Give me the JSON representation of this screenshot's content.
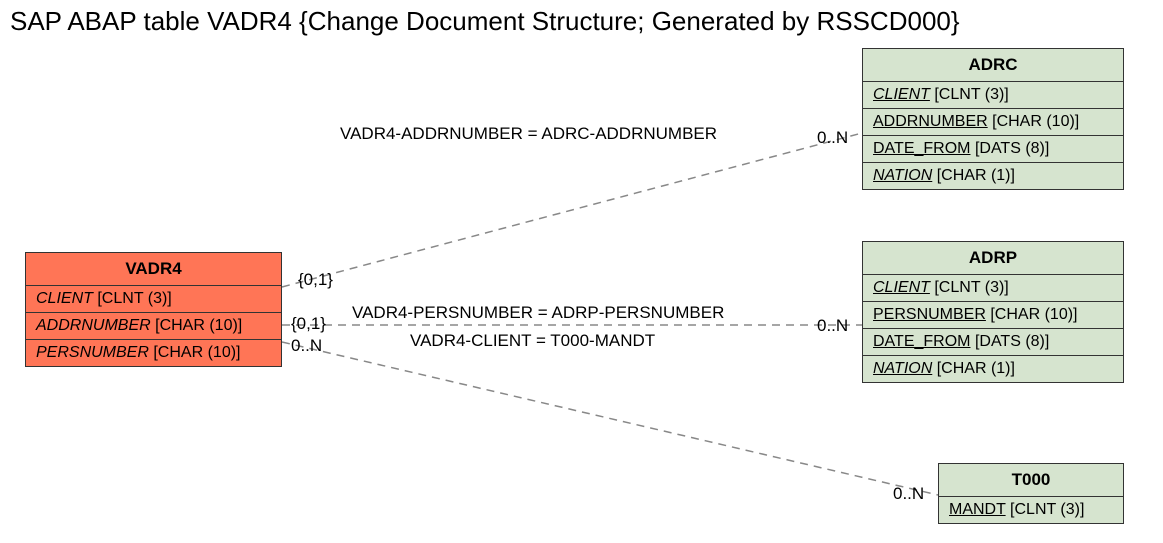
{
  "title": "SAP ABAP table VADR4 {Change Document Structure; Generated by RSSCD000}",
  "entities": {
    "vadr4": {
      "name": "VADR4",
      "fields": [
        {
          "label": "CLIENT",
          "type": "[CLNT (3)]",
          "italic": true,
          "under": false
        },
        {
          "label": "ADDRNUMBER",
          "type": "[CHAR (10)]",
          "italic": true,
          "under": false
        },
        {
          "label": "PERSNUMBER",
          "type": "[CHAR (10)]",
          "italic": true,
          "under": false
        }
      ]
    },
    "adrc": {
      "name": "ADRC",
      "fields": [
        {
          "label": "CLIENT",
          "type": "[CLNT (3)]",
          "italic": true,
          "under": true
        },
        {
          "label": "ADDRNUMBER",
          "type": "[CHAR (10)]",
          "italic": false,
          "under": true
        },
        {
          "label": "DATE_FROM",
          "type": "[DATS (8)]",
          "italic": false,
          "under": true
        },
        {
          "label": "NATION",
          "type": "[CHAR (1)]",
          "italic": true,
          "under": true
        }
      ]
    },
    "adrp": {
      "name": "ADRP",
      "fields": [
        {
          "label": "CLIENT",
          "type": "[CLNT (3)]",
          "italic": true,
          "under": true
        },
        {
          "label": "PERSNUMBER",
          "type": "[CHAR (10)]",
          "italic": false,
          "under": true
        },
        {
          "label": "DATE_FROM",
          "type": "[DATS (8)]",
          "italic": false,
          "under": true
        },
        {
          "label": "NATION",
          "type": "[CHAR (1)]",
          "italic": true,
          "under": true
        }
      ]
    },
    "t000": {
      "name": "T000",
      "fields": [
        {
          "label": "MANDT",
          "type": "[CLNT (3)]",
          "italic": false,
          "under": true
        }
      ]
    }
  },
  "relations": {
    "r1": {
      "text": "VADR4-ADDRNUMBER = ADRC-ADDRNUMBER",
      "left_card": "{0,1}",
      "right_card": "0..N"
    },
    "r2": {
      "text": "VADR4-PERSNUMBER = ADRP-PERSNUMBER",
      "left_card": "{0,1}",
      "right_card": "0..N"
    },
    "r3": {
      "text": "VADR4-CLIENT = T000-MANDT",
      "left_card": "0..N",
      "right_card": "0..N"
    }
  }
}
